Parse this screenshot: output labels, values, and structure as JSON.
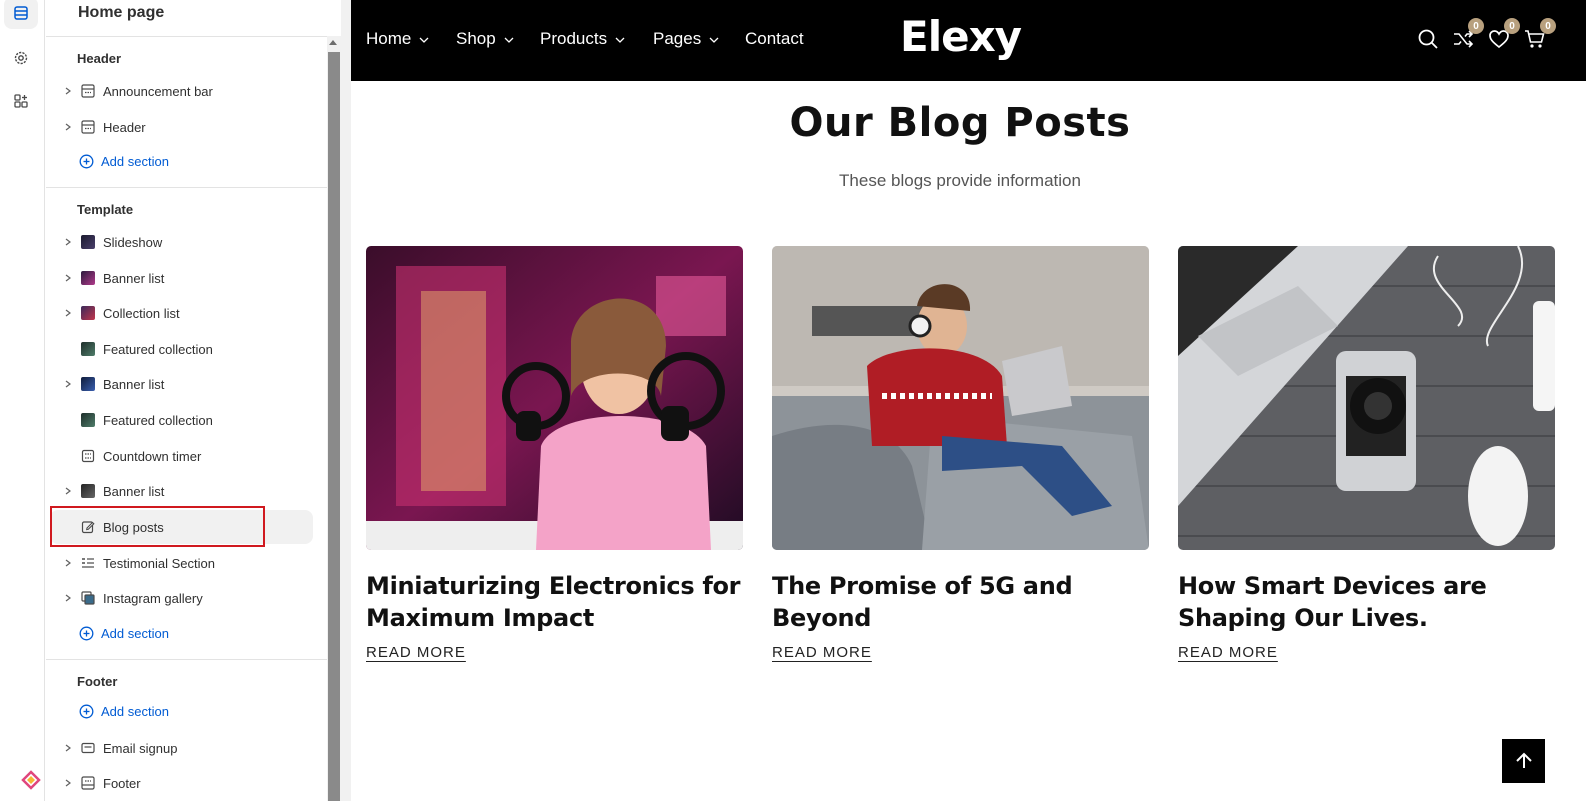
{
  "sidebar": {
    "title": "Home page",
    "groups": {
      "header": "Header",
      "template": "Template",
      "footer": "Footer"
    },
    "header_items": [
      {
        "label": "Announcement bar",
        "icon": "layout-icon"
      },
      {
        "label": "Header",
        "icon": "layout-icon"
      }
    ],
    "template_items": [
      {
        "label": "Slideshow",
        "icon": "image-thumb"
      },
      {
        "label": "Banner list",
        "icon": "image-thumb"
      },
      {
        "label": "Collection list",
        "icon": "image-thumb"
      },
      {
        "label": "Featured collection",
        "icon": "image-thumb"
      },
      {
        "label": "Banner list",
        "icon": "image-thumb"
      },
      {
        "label": "Featured collection",
        "icon": "image-thumb"
      },
      {
        "label": "Countdown timer",
        "icon": "timer-icon"
      },
      {
        "label": "Banner list",
        "icon": "image-thumb"
      },
      {
        "label": "Blog posts",
        "icon": "edit-icon"
      },
      {
        "label": "Testimonial Section",
        "icon": "list-icon"
      },
      {
        "label": "Instagram gallery",
        "icon": "image-thumb"
      }
    ],
    "footer_items": [
      {
        "label": "Email signup",
        "icon": "email-icon"
      },
      {
        "label": "Footer",
        "icon": "layout-icon"
      }
    ],
    "add_section": "Add section"
  },
  "preview": {
    "nav": {
      "items": [
        "Home",
        "Shop",
        "Products",
        "Pages",
        "Contact"
      ],
      "logo": "Elexy",
      "badges": {
        "compare": "0",
        "wishlist": "0",
        "cart": "0"
      }
    },
    "blog": {
      "title": "Our Blog Posts",
      "subtitle": "These blogs provide information",
      "posts": [
        {
          "title": "Miniaturizing Electronics for Maximum Impact",
          "link": "READ MORE"
        },
        {
          "title": "The Promise of 5G and Beyond",
          "link": "READ MORE"
        },
        {
          "title": "How Smart Devices are Shaping Our Lives.",
          "link": "READ MORE"
        }
      ]
    }
  },
  "colors": {
    "nav_bg": "#000000",
    "accent_link": "#005bd3",
    "badge": "#b8a07e",
    "highlight": "#d0191f"
  }
}
